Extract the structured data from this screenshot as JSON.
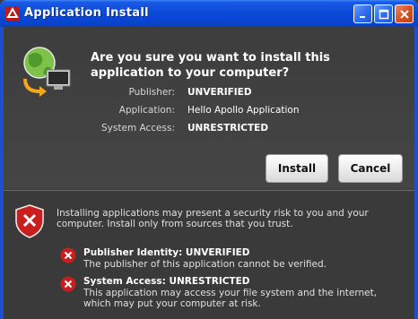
{
  "window": {
    "title": "Application Install",
    "controls": {
      "minimize": "minimize",
      "maximize": "maximize",
      "close": "close"
    }
  },
  "header": {
    "headline": "Are you sure you want to install this application to your computer?",
    "details": [
      {
        "label": "Publisher:",
        "value": "UNVERIFIED",
        "bold": true
      },
      {
        "label": "Application:",
        "value": "Hello Apollo Application",
        "bold": false
      },
      {
        "label": "System Access:",
        "value": "UNRESTRICTED",
        "bold": true
      }
    ]
  },
  "buttons": {
    "install": "Install",
    "cancel": "Cancel"
  },
  "warning": {
    "text": "Installing applications may present a security risk to you and your computer. Install only from sources that you trust.",
    "items": [
      {
        "title": "Publisher Identity: UNVERIFIED",
        "description": "The publisher of this application cannot be verified."
      },
      {
        "title": "System Access: UNRESTRICTED",
        "description": "This application may access your file system and the internet, which may put your computer at risk."
      }
    ]
  },
  "colors": {
    "titlebar": "#0a49d8",
    "panel": "#404040",
    "error_red": "#c81e1e"
  }
}
